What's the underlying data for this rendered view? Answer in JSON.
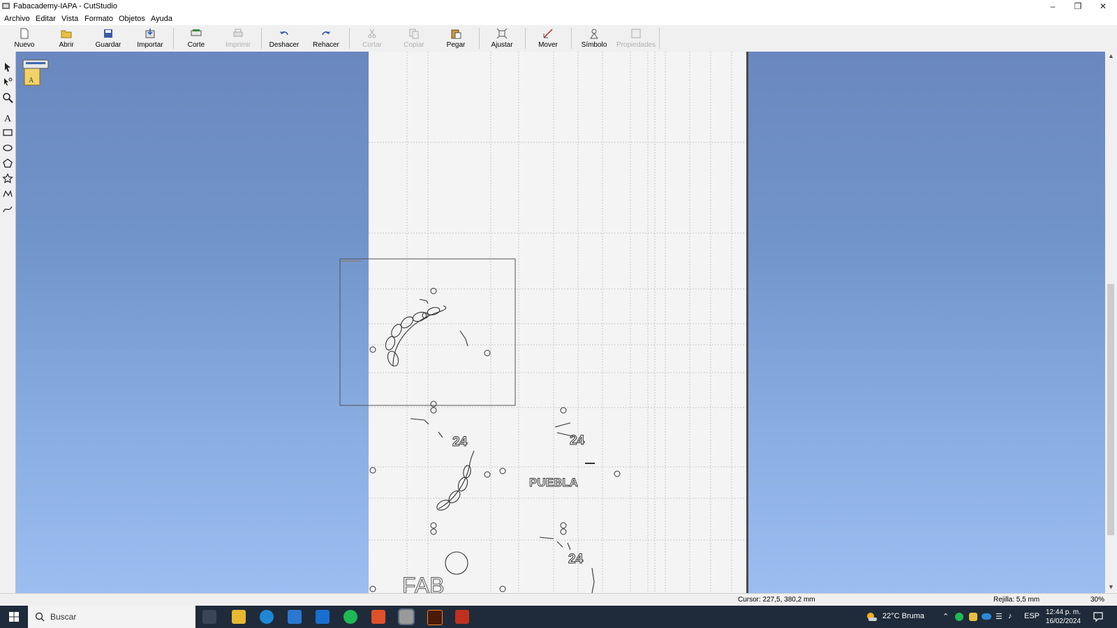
{
  "window": {
    "title": "Fabacademy-IAPA - CutStudio"
  },
  "menu": [
    "Archivo",
    "Editar",
    "Vista",
    "Formato",
    "Objetos",
    "Ayuda"
  ],
  "toolbar": {
    "nuevo": "Nuevo",
    "abrir": "Abrir",
    "guardar": "Guardar",
    "importar": "Importar",
    "corte": "Corte",
    "imprimir": "Imprimir",
    "deshacer": "Deshacer",
    "rehacer": "Rehacer",
    "cortar": "Cortar",
    "copiar": "Copiar",
    "pegar": "Pegar",
    "ajustar": "Ajustar",
    "mover": "Mover",
    "simbolo": "Símbolo",
    "propiedades": "Propiedades"
  },
  "canvas": {
    "text_puebla": "PUEBLA",
    "text_fab": "FAB",
    "text_24": "24"
  },
  "status": {
    "cursor": "Cursor: 227,5, 380,2 mm",
    "grid": "Rejilla: 5,5 mm",
    "zoom": "30%"
  },
  "taskbar": {
    "search_placeholder": "Buscar",
    "weather": "22°C  Bruma",
    "lang": "ESP",
    "time": "12:44 p. m.",
    "date": "16/02/2024"
  },
  "colors": {
    "workspace": "#7194cb",
    "sheet": "#f4f4f4",
    "taskbar": "#1f2b3a"
  }
}
